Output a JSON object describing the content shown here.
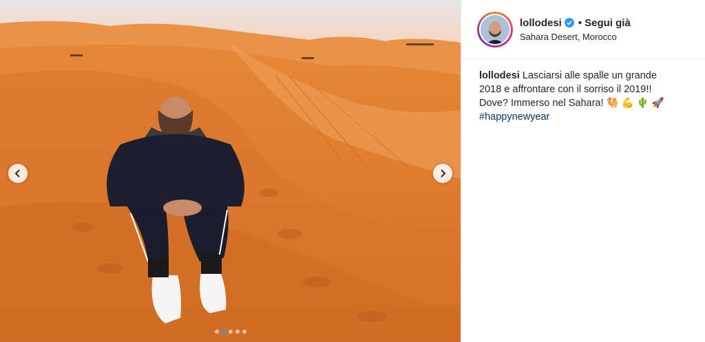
{
  "post": {
    "username": "lollodesi",
    "follow_separator": "•",
    "follow_status": "Segui già",
    "location": "Sahara Desert, Morocco",
    "caption_line1": "Lasciarsi alle spalle un grande",
    "caption_line2": "2018 e affrontare con il sorriso il 2019!!",
    "caption_line3": "Dove? Immerso nel Sahara!",
    "emojis": [
      "🐫",
      "💪",
      "🌵",
      "🚀"
    ],
    "hashtag": "#happynewyear"
  },
  "carousel": {
    "total_slides": 5,
    "active_index": 1
  },
  "colors": {
    "verified": "#3897f0",
    "active_dot": "#3897f0",
    "hashtag": "#003569",
    "sand": "#d9772c"
  }
}
